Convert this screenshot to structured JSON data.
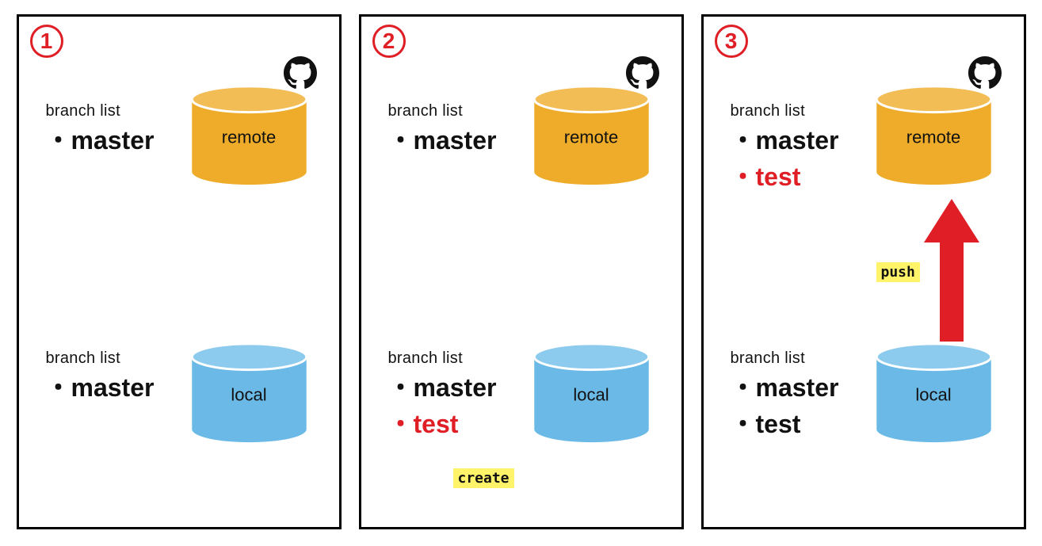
{
  "labels": {
    "branch_list_title": "branch list",
    "remote_label": "remote",
    "local_label": "local",
    "master": "・master",
    "test": "・test",
    "create_tag": "create",
    "push_tag": "push"
  },
  "colors": {
    "remote_fill": "#eeac2a",
    "remote_stroke": "#eeac2a",
    "local_fill": "#6ab9e6",
    "local_stroke": "#6ab9e6",
    "accent_red": "#e01e25",
    "highlight": "#fff36a"
  },
  "icons": {
    "github": "github-icon"
  },
  "panels": [
    {
      "step": "1",
      "remote_branches": [
        {
          "name": "master",
          "new": false
        }
      ],
      "local_branches": [
        {
          "name": "master",
          "new": false
        }
      ],
      "show_create_tag": false,
      "show_push_arrow": false
    },
    {
      "step": "2",
      "remote_branches": [
        {
          "name": "master",
          "new": false
        }
      ],
      "local_branches": [
        {
          "name": "master",
          "new": false
        },
        {
          "name": "test",
          "new": true
        }
      ],
      "show_create_tag": true,
      "show_push_arrow": false
    },
    {
      "step": "3",
      "remote_branches": [
        {
          "name": "master",
          "new": false
        },
        {
          "name": "test",
          "new": true
        }
      ],
      "local_branches": [
        {
          "name": "master",
          "new": false
        },
        {
          "name": "test",
          "new": false
        }
      ],
      "show_create_tag": false,
      "show_push_arrow": true
    }
  ]
}
